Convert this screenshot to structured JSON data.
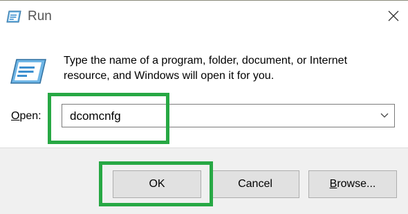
{
  "window": {
    "title": "Run",
    "close_glyph": "✕"
  },
  "content": {
    "description": "Type the name of a program, folder, document, or Internet resource, and Windows will open it for you.",
    "open_label_accel": "O",
    "open_label_rest": "pen:",
    "open_value": "dcomcnfg"
  },
  "buttons": {
    "ok": "OK",
    "cancel": "Cancel",
    "browse_accel": "B",
    "browse_rest": "rowse..."
  },
  "colors": {
    "highlight": "#27a844",
    "footer_bg": "#f0f0f0",
    "button_bg": "#e1e1e1"
  },
  "icons": {
    "title": "run-app-icon",
    "dialog": "run-app-icon",
    "close": "close-icon",
    "dropdown": "chevron-down-icon"
  }
}
